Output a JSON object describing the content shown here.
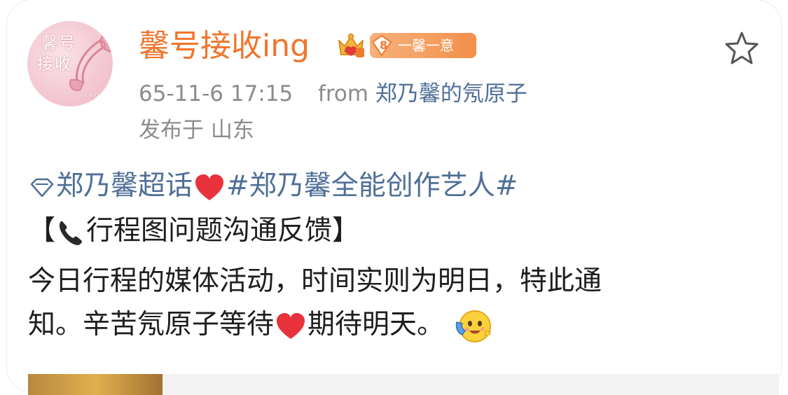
{
  "post": {
    "username": "馨号接收ing",
    "avatar_text": {
      "line1": "馨号",
      "line2": "接收",
      "line3": "ing"
    },
    "fan_badge": {
      "level": "8",
      "name": "一馨一意"
    },
    "time": "65-11-6 17:15",
    "from_label": "from",
    "source": "郑乃馨的氖原子",
    "location": "发布于 山东",
    "topics": {
      "super_topic": "郑乃馨超话",
      "hashtag": "#郑乃馨全能创作艺人#"
    },
    "body": {
      "bracket_open": "【",
      "bracket_title": "行程图问题沟通反馈】",
      "line3": "今日行程的媒体活动，时间实则为明日，特此通",
      "line4a": "知。辛苦氖原子等待",
      "line4b": "期待明天。"
    }
  },
  "icons": {
    "favorite": "star-outline-icon",
    "super_topic": "diamond-icon",
    "heart": "red-heart-emoji",
    "phone": "telephone-receiver-emoji",
    "emoji_end": "hugging-face-emoji"
  },
  "colors": {
    "username": "#f0752d",
    "link": "#4f6f97",
    "meta": "#8c8c8c",
    "text": "#1e1e1e",
    "heart": "#e8323c"
  }
}
